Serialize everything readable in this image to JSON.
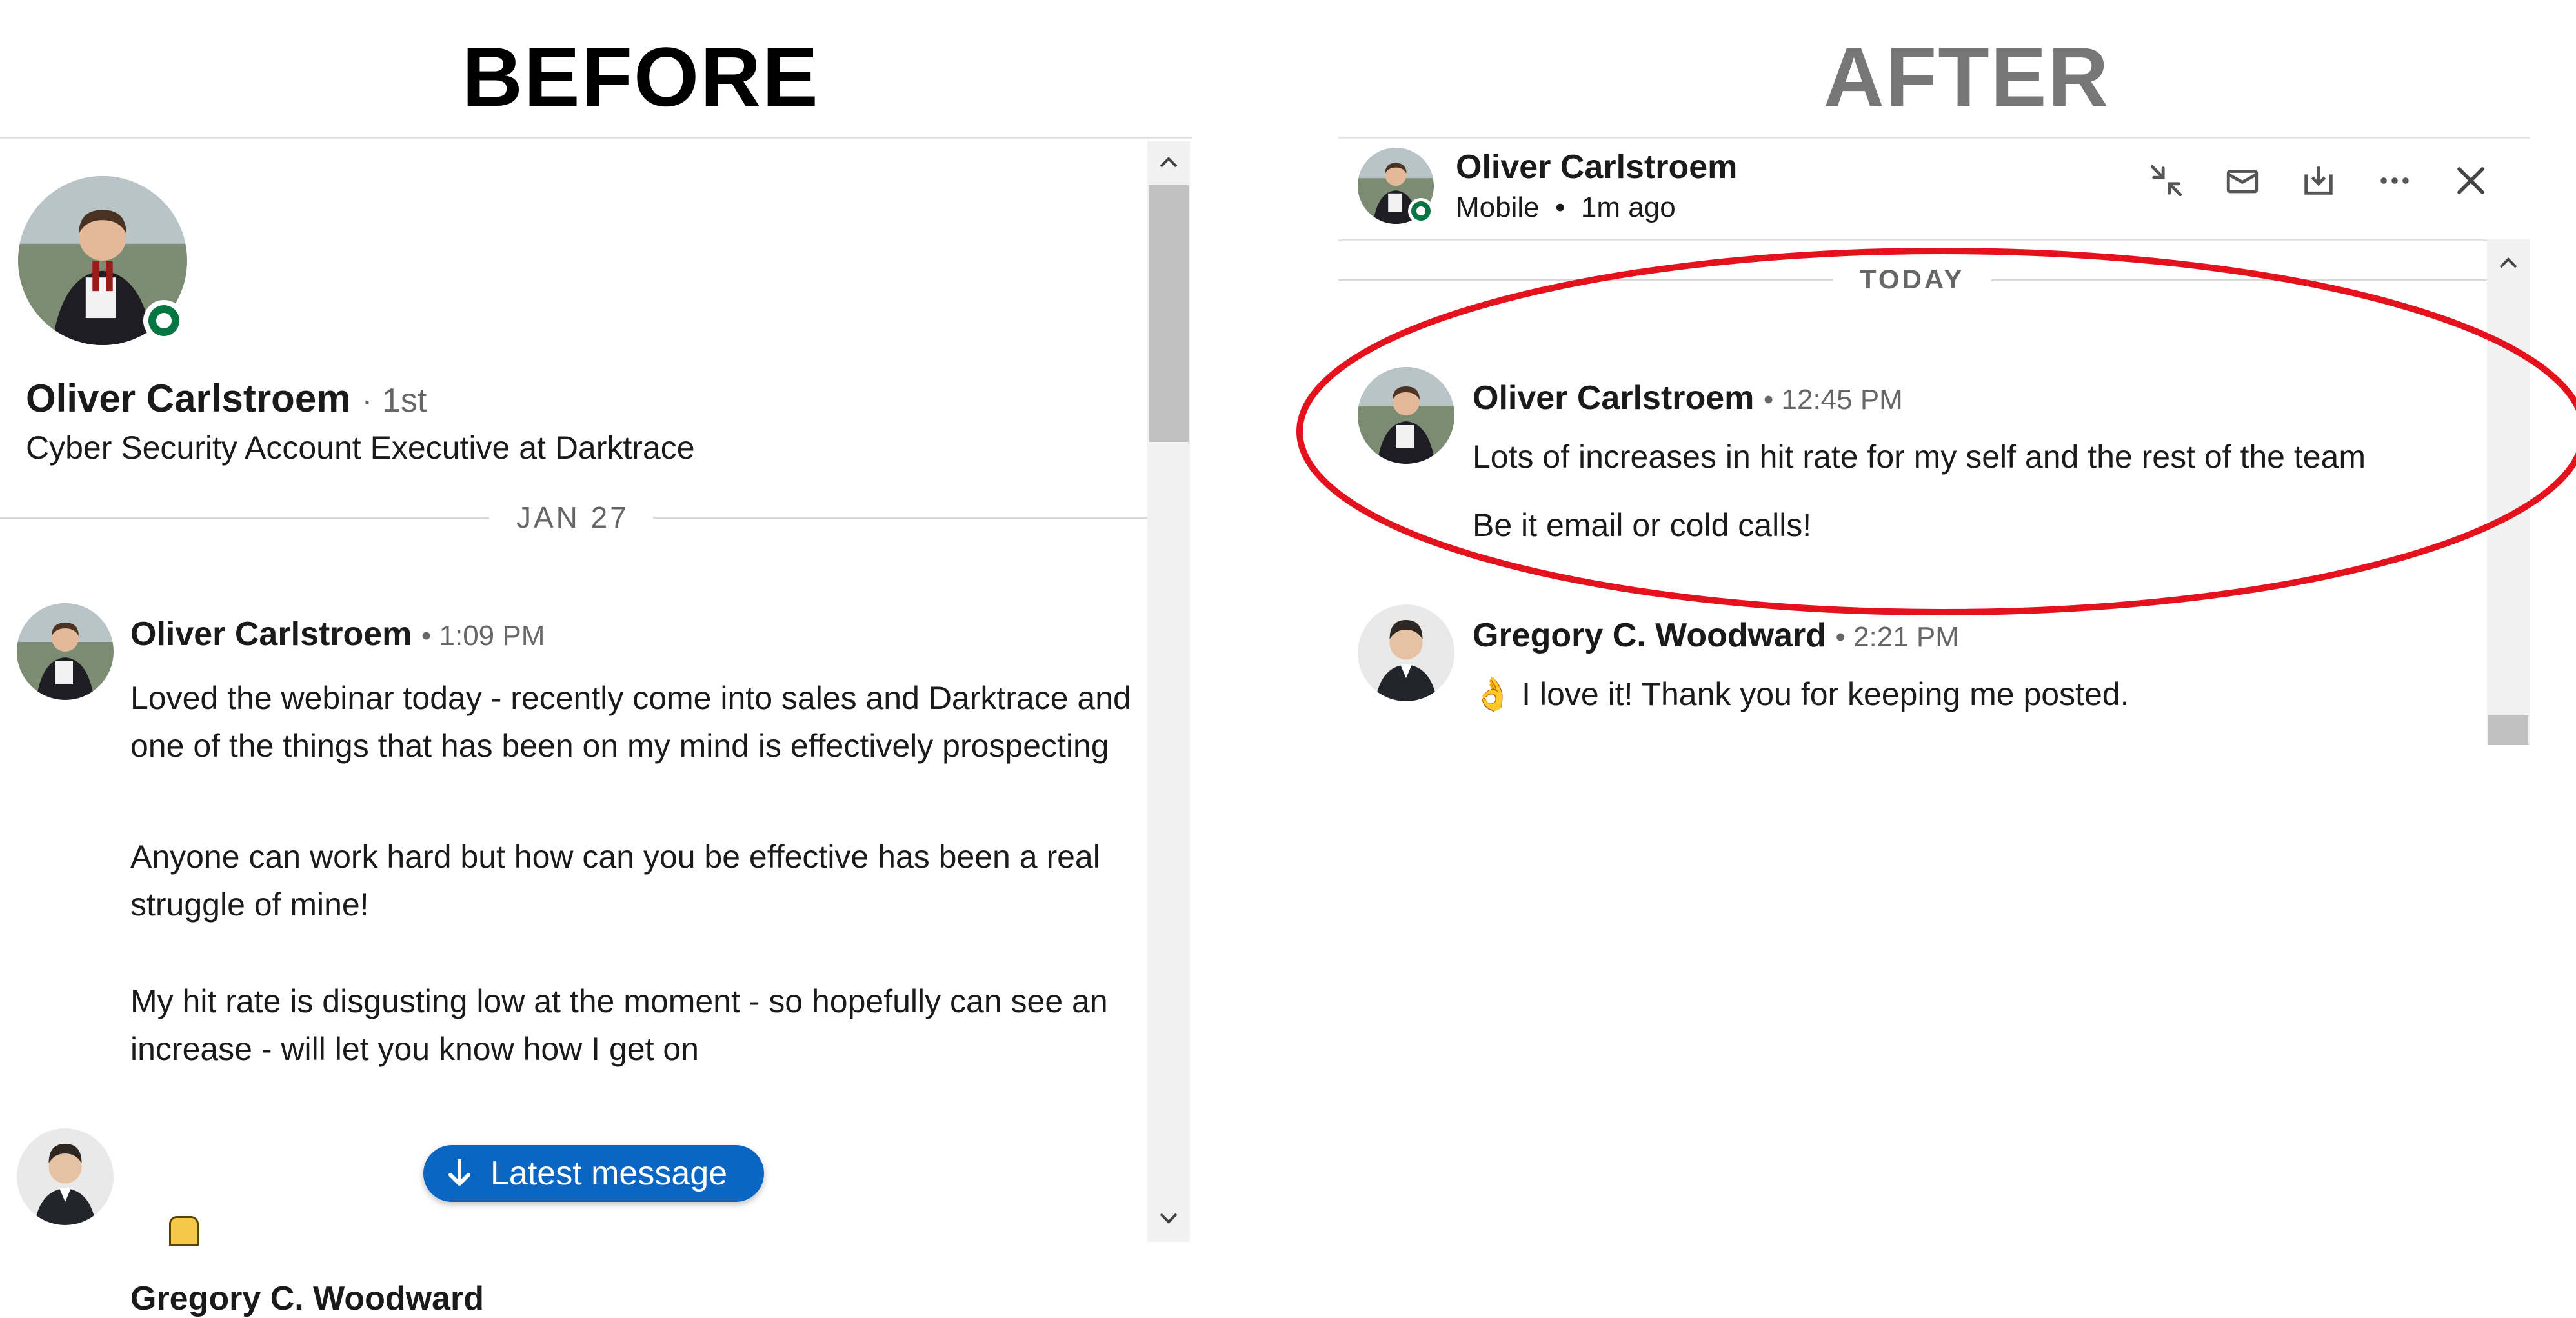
{
  "labels": {
    "before": "BEFORE",
    "after": "AFTER"
  },
  "before_panel": {
    "profile": {
      "name": "Oliver Carlstroem",
      "degree": "· 1st",
      "headline": "Cyber Security Account Executive at Darktrace"
    },
    "date_divider": "JAN 27",
    "messages": [
      {
        "sender": "Oliver Carlstroem",
        "time": "• 1:09 PM",
        "paragraphs": [
          "Loved the webinar today - recently come into sales and Darktrace and one of the things that has been on my mind is effectively prospecting",
          "Anyone can work hard but how can you be effective has been a real struggle of mine!",
          "My hit rate is disgusting low at the moment - so hopefully can see an increase - will let you know how I get on"
        ]
      },
      {
        "sender": "Gregory C. Woodward"
      }
    ],
    "latest_button": "Latest message"
  },
  "after_panel": {
    "header": {
      "name": "Oliver Carlstroem",
      "status": "Mobile  •  1m ago",
      "icons": [
        "collapse-icon",
        "envelope-icon",
        "download-icon",
        "more-icon",
        "close-icon"
      ]
    },
    "date_divider": "TODAY",
    "messages": [
      {
        "sender": "Oliver Carlstroem",
        "time": "• 12:45 PM",
        "lines": [
          "Lots of increases in hit rate for my self and the rest of the team",
          "Be it email or cold calls!"
        ]
      },
      {
        "sender": "Gregory C. Woodward",
        "time": "• 2:21 PM",
        "emoji": "👌",
        "text": "I love it! Thank you for keeping me posted."
      }
    ]
  },
  "colors": {
    "highlight": "#e3121c",
    "online": "#057642",
    "button": "#0a66c2"
  }
}
